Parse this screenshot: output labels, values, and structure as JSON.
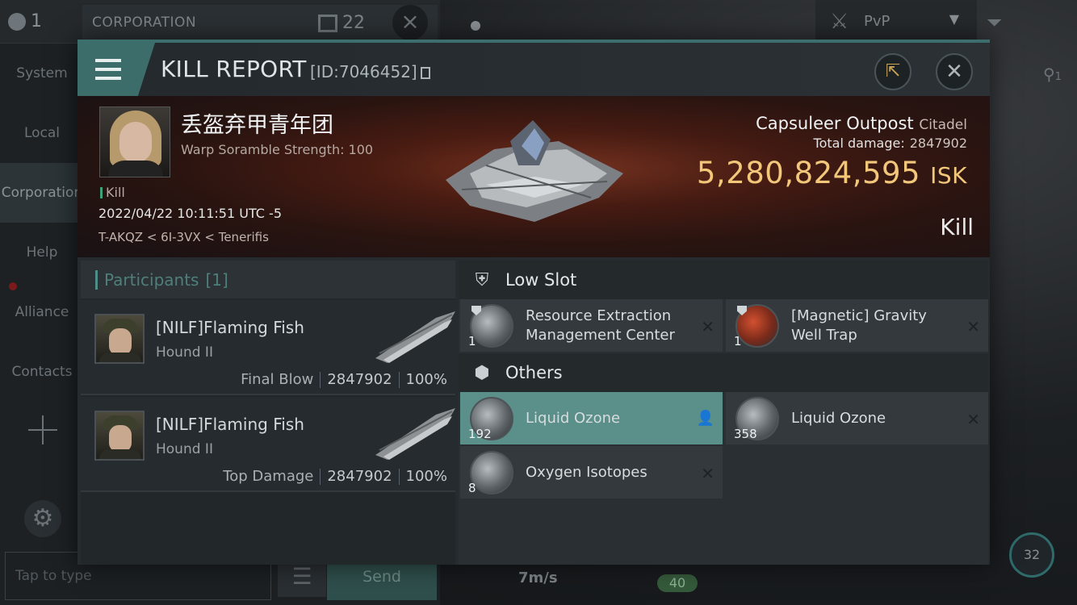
{
  "background": {
    "member_count": "1",
    "channel_tab": "CORPORATION",
    "channel_count": "22",
    "nav": [
      "System",
      "Local",
      "Corporation",
      "Help",
      "Alliance",
      "Contacts"
    ],
    "active_nav": "Corporation",
    "chat_placeholder": "Tap to type",
    "send_label": "Send",
    "mode_label": "PvP",
    "speed": "7m/s",
    "drone_count": "40",
    "target_count": "32",
    "search_count": "1"
  },
  "header": {
    "title": "KILL REPORT",
    "id_text": "[ID:7046452]"
  },
  "victim": {
    "name": "丢盔弃甲青年团",
    "subtitle": "Warp Soramble Strength: 100",
    "tag": "Kill",
    "time": "2022/04/22 10:11:51 UTC -5",
    "location": "T-AKQZ < 6I-3VX < Tenerifis",
    "structure": "Capsuleer Outpost",
    "structure_class": "Citadel",
    "total_damage_label": "Total damage:",
    "total_damage": "2847902",
    "isk_value": "5,280,824,595",
    "isk_unit": "ISK",
    "kind": "Kill"
  },
  "participants": {
    "title": "Participants",
    "count": "[1]",
    "rows": [
      {
        "name": "[NILF]Flaming Fish",
        "ship": "Hound II",
        "label": "Final Blow",
        "damage": "2847902",
        "percent": "100%"
      },
      {
        "name": "[NILF]Flaming Fish",
        "ship": "Hound II",
        "label": "Top Damage",
        "damage": "2847902",
        "percent": "100%"
      }
    ]
  },
  "sections": {
    "low_slot": {
      "title": "Low Slot",
      "items": [
        {
          "qty": "1",
          "line1": "Resource Extraction",
          "line2": "Management Center"
        },
        {
          "qty": "1",
          "line1": "[Magnetic] Gravity",
          "line2": "Well Trap"
        }
      ]
    },
    "others": {
      "title": "Others",
      "items": [
        {
          "qty": "192",
          "name": "Liquid Ozone",
          "selected": true
        },
        {
          "qty": "358",
          "name": "Liquid Ozone",
          "selected": false
        },
        {
          "qty": "8",
          "name": "Oxygen Isotopes",
          "selected": false
        }
      ]
    }
  },
  "colors": {
    "accent": "#3b6e6c",
    "isk": "#f3c77a",
    "selected_item": "#5b8f8a"
  }
}
